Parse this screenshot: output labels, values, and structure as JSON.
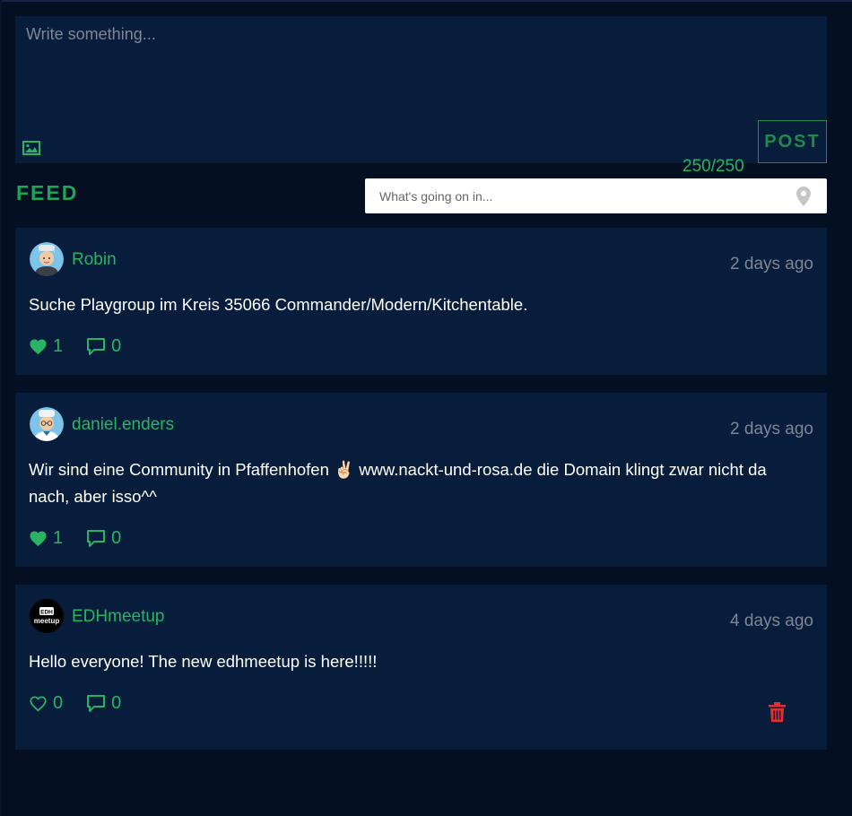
{
  "composer": {
    "placeholder": "Write something...",
    "char_count": "250/250",
    "post_label": "POST"
  },
  "feed": {
    "title": "FEED",
    "search_placeholder": "What's going on in..."
  },
  "posts": [
    {
      "username": "Robin",
      "time": "2 days ago",
      "text": "Suche Playgroup im Kreis 35066 Commander/Modern/Kitchentable.",
      "likes": "1",
      "comments": "0",
      "liked": true
    },
    {
      "username": "daniel.enders",
      "time": "2 days ago",
      "text": "Wir sind eine Community in Pfaffenhofen ✌🏻 www.nackt-und-rosa.de die Domain klingt zwar nicht da nach, aber isso^^",
      "likes": "1",
      "comments": "0",
      "liked": true
    },
    {
      "username": "EDHmeetup",
      "avatar_text_top": "EDH",
      "avatar_text_bottom": "meetup",
      "time": "4 days ago",
      "text": "Hello everyone! The new edhmeetup is here!!!!!",
      "likes": "0",
      "comments": "0",
      "liked": false
    }
  ],
  "colors": {
    "background": "#050f22",
    "card": "#081d3c",
    "accent": "#28b463",
    "delete": "#e03131"
  }
}
